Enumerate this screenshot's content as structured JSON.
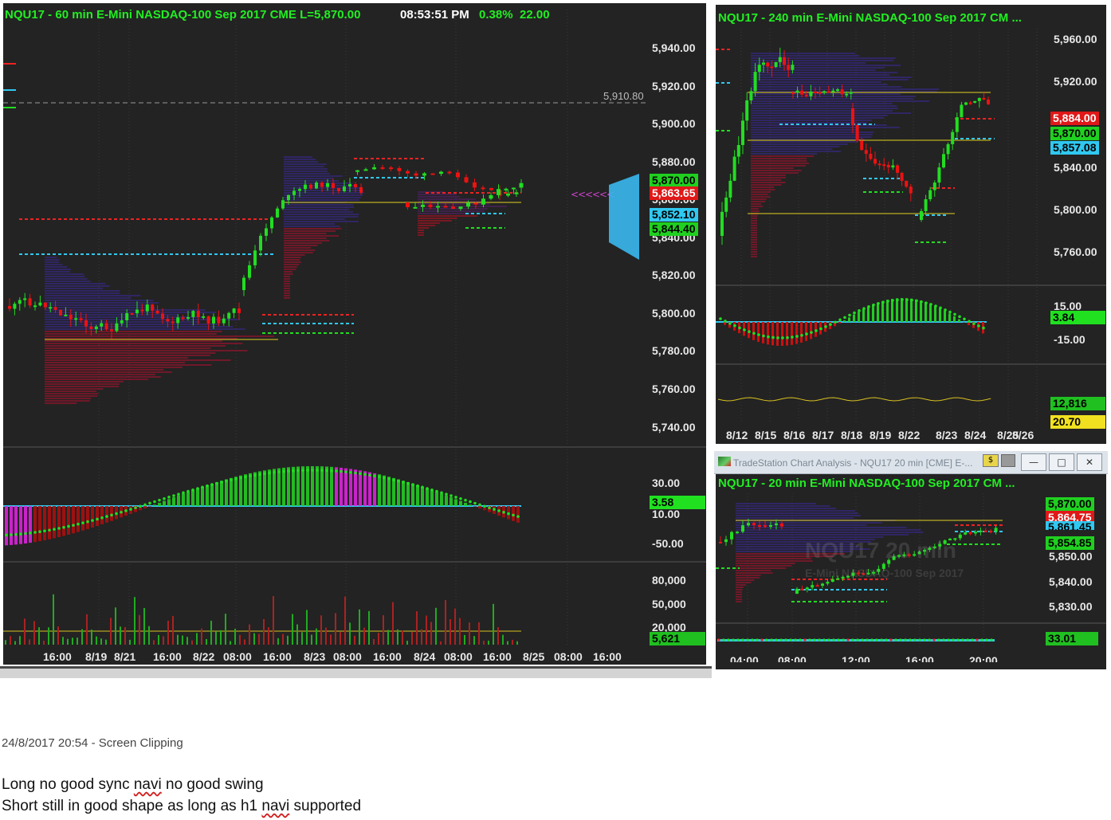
{
  "main_chart": {
    "title": "NQU17 - 60 min  E-Mini NASDAQ-100 Sep 2017  CME  L=5,870.00",
    "time": "08:53:51 PM",
    "change_pct": "0.38%",
    "change": "22.00",
    "ref_line_label": "5,910.80",
    "price_labels": [
      "5,940.00",
      "5,920.00",
      "5,900.00",
      "5,880.00",
      "5,860.00",
      "5,840.00",
      "5,820.00",
      "5,800.00",
      "5,780.00",
      "5,760.00",
      "5,740.00"
    ],
    "price_tags": [
      {
        "text": "5,870.00",
        "bg": "#20d020",
        "fg": "#000000"
      },
      {
        "text": "5,863.65",
        "bg": "#e01818",
        "fg": "#ffffff"
      },
      {
        "text": "5,852.10",
        "bg": "#30c8f0",
        "fg": "#000000"
      },
      {
        "text": "5,844.40",
        "bg": "#20d020",
        "fg": "#000000"
      }
    ],
    "osc_labels": [
      "30.00",
      "10.00",
      "-50.00"
    ],
    "osc_tag": {
      "text": "3.58",
      "bg": "#20e020",
      "fg": "#000000"
    },
    "vol_labels": [
      "80,000",
      "50,000",
      "20,000"
    ],
    "vol_tag": {
      "text": "5,621",
      "bg": "#20c020",
      "fg": "#000000"
    },
    "time_labels": [
      "16:00",
      "8/19",
      "8/21",
      "16:00",
      "8/22",
      "08:00",
      "16:00",
      "8/23",
      "08:00",
      "16:00",
      "8/24",
      "08:00",
      "16:00",
      "8/25",
      "08:00",
      "16:00"
    ]
  },
  "chart_240": {
    "title": "NQU17 - 240 min  E-Mini NASDAQ-100 Sep 2017  CM ...",
    "price_labels": [
      "5,960.00",
      "5,920.00",
      "5,880.00",
      "5,840.00",
      "5,800.00",
      "5,760.00"
    ],
    "price_tags": [
      {
        "text": "5,884.00",
        "bg": "#e01818",
        "fg": "#ffffff"
      },
      {
        "text": "5,870.00",
        "bg": "#20d020",
        "fg": "#000000"
      },
      {
        "text": "5,857.08",
        "bg": "#30c8f0",
        "fg": "#000000"
      }
    ],
    "osc_labels": [
      "15.00",
      "-15.00"
    ],
    "osc_tag": {
      "text": "3.84",
      "bg": "#20e020",
      "fg": "#000000"
    },
    "vol_tags": [
      {
        "text": "12,816",
        "bg": "#20c020",
        "fg": "#000000"
      },
      {
        "text": "20.70",
        "bg": "#f0e020",
        "fg": "#000000"
      }
    ],
    "time_labels": [
      "8/12",
      "8/15",
      "8/16",
      "8/17",
      "8/18",
      "8/19",
      "8/22",
      "8/23",
      "8/24",
      "8/25",
      "8/26"
    ]
  },
  "chart_20": {
    "window_title": "TradeStation Chart Analysis - NQU17 20 min [CME] E-...",
    "title": "NQU17 - 20 min  E-Mini NASDAQ-100 Sep 2017  CM ...",
    "watermark_line1": "NQU17 20 min",
    "watermark_line2": "E-Mini NASDAQ-100 Sep 2017",
    "price_labels": [
      "5,850.00",
      "5,840.00",
      "5,830.00"
    ],
    "price_tags": [
      {
        "text": "5,870.00",
        "bg": "#20d020",
        "fg": "#000000"
      },
      {
        "text": "5,864.75",
        "bg": "#e01818",
        "fg": "#ffffff"
      },
      {
        "text": "5,861.45",
        "bg": "#30c8f0",
        "fg": "#000000"
      },
      {
        "text": "5,854.85",
        "bg": "#20d020",
        "fg": "#000000"
      }
    ],
    "osc_tag": {
      "text": "33.01",
      "bg": "#20c020",
      "fg": "#000000"
    },
    "time_labels": [
      "04:00",
      "08:00",
      "12:00",
      "16:00",
      "20:00"
    ]
  },
  "notes": {
    "clip_info": "24/8/2017 20:54 - Screen Clipping",
    "line1_a": "Long no good sync ",
    "line1_b": "navi",
    "line1_c": " no good swing",
    "line2_a": "Short still in good shape as long as h1 ",
    "line2_b": "navi",
    "line2_c": " supported"
  },
  "colors": {
    "bull": "#22dd22",
    "bear": "#ee1111",
    "pane": "#232323",
    "accent_cyan": "#30c8f0"
  }
}
